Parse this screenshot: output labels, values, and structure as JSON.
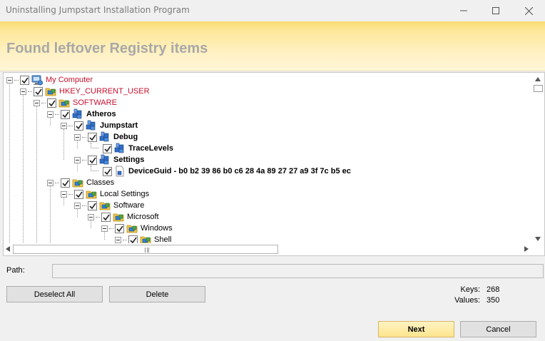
{
  "window": {
    "title": "Uninstalling Jumpstart Installation Program"
  },
  "header": {
    "heading": "Found leftover Registry items"
  },
  "tree": [
    {
      "label": "My Computer",
      "style": "red",
      "icon": "computer-icon",
      "depth": 0,
      "checked": true
    },
    {
      "label": "HKEY_CURRENT_USER",
      "style": "red",
      "icon": "registry-folder-icon",
      "depth": 1,
      "checked": true
    },
    {
      "label": "SOFTWARE",
      "style": "red",
      "icon": "registry-folder-icon",
      "depth": 2,
      "checked": true
    },
    {
      "label": "Atheros",
      "style": "bold",
      "icon": "registry-key-icon",
      "depth": 3,
      "checked": true
    },
    {
      "label": "Jumpstart",
      "style": "bold",
      "icon": "registry-key-icon",
      "depth": 4,
      "checked": true
    },
    {
      "label": "Debug",
      "style": "bold",
      "icon": "registry-key-icon",
      "depth": 5,
      "checked": true
    },
    {
      "label": "TraceLevels",
      "style": "bold",
      "icon": "registry-key-icon",
      "depth": 6,
      "checked": true,
      "leaf": true
    },
    {
      "label": "Settings",
      "style": "bold",
      "icon": "registry-key-icon",
      "depth": 5,
      "checked": true
    },
    {
      "label": "DeviceGuid - b0 b2 39 86 b0 c6 28 4a 89 27 27 a9 3f 7c b5 ec",
      "style": "bold",
      "icon": "registry-value-icon",
      "depth": 6,
      "checked": true,
      "leaf": true
    },
    {
      "label": "Classes",
      "style": "normal",
      "icon": "registry-folder-icon",
      "depth": 3,
      "checked": true
    },
    {
      "label": "Local Settings",
      "style": "normal",
      "icon": "registry-folder-icon",
      "depth": 4,
      "checked": true
    },
    {
      "label": "Software",
      "style": "normal",
      "icon": "registry-folder-icon",
      "depth": 5,
      "checked": true
    },
    {
      "label": "Microsoft",
      "style": "normal",
      "icon": "registry-folder-icon",
      "depth": 6,
      "checked": true
    },
    {
      "label": "Windows",
      "style": "normal",
      "icon": "registry-folder-icon",
      "depth": 7,
      "checked": true
    },
    {
      "label": "Shell",
      "style": "normal",
      "icon": "registry-folder-icon",
      "depth": 8,
      "checked": true
    }
  ],
  "path": {
    "label": "Path:",
    "value": ""
  },
  "buttons": {
    "deselect_all": "Deselect All",
    "delete": "Delete",
    "next": "Next",
    "cancel": "Cancel"
  },
  "stats": {
    "keys_label": "Keys:",
    "keys_value": "268",
    "values_label": "Values:",
    "values_value": "350"
  },
  "colors": {
    "header_gradient_top": "#fbdc73",
    "header_text": "#a8a8a8",
    "tree_red_text": "#c8102e",
    "next_button": "#fde58e"
  }
}
